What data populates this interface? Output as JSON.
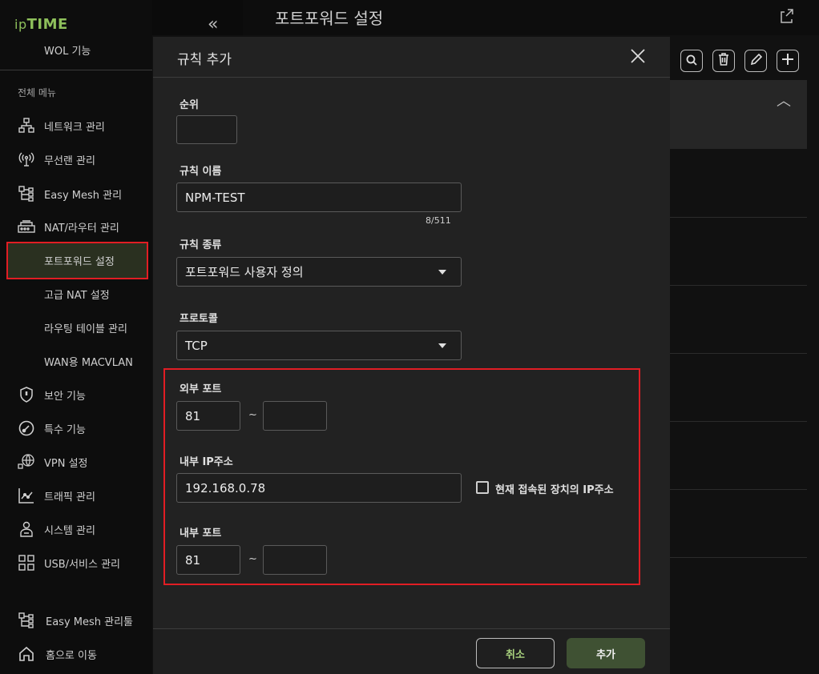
{
  "brand": {
    "logo_prefix": "ip",
    "logo_main": "TIME"
  },
  "sidebar": {
    "collapse_icon": "double-chevron-left-icon",
    "top_item": "WOL 기능",
    "section_label": "전체 메뉴",
    "items": [
      {
        "label": "네트워크 관리",
        "icon": "network-icon"
      },
      {
        "label": "무선랜 관리",
        "icon": "wireless-icon"
      },
      {
        "label": "Easy Mesh 관리",
        "icon": "mesh-icon"
      },
      {
        "label": "NAT/라우터 관리",
        "icon": "router-icon"
      },
      {
        "label": "포트포워드 설정",
        "icon": ""
      },
      {
        "label": "고급 NAT 설정",
        "icon": ""
      },
      {
        "label": "라우팅 테이블 관리",
        "icon": ""
      },
      {
        "label": "WAN용 MACVLAN",
        "icon": ""
      },
      {
        "label": "보안 기능",
        "icon": "shield-icon"
      },
      {
        "label": "특수 기능",
        "icon": "gauge-icon"
      },
      {
        "label": "VPN 설정",
        "icon": "globe-icon"
      },
      {
        "label": "트래픽 관리",
        "icon": "chart-icon"
      },
      {
        "label": "시스템 관리",
        "icon": "system-icon"
      },
      {
        "label": "USB/서비스 관리",
        "icon": "usb-icon"
      }
    ],
    "bottom_items": [
      {
        "label": "Easy Mesh 관리툴",
        "icon": "mesh-tool-icon"
      },
      {
        "label": "홈으로 이동",
        "icon": "home-icon"
      }
    ]
  },
  "page": {
    "title": "포트포워드 설정"
  },
  "modal": {
    "title": "규칙 추가",
    "fields": {
      "order_label": "순위",
      "order_value": "",
      "name_label": "규칙 이름",
      "name_value": "NPM-TEST",
      "name_counter": "8/511",
      "type_label": "규칙 종류",
      "type_value": "포트포워드 사용자 정의",
      "protocol_label": "프로토콜",
      "protocol_value": "TCP",
      "ext_port_label": "외부 포트",
      "ext_port_start": "81",
      "ext_port_end": "",
      "int_ip_label": "내부 IP주소",
      "int_ip_value": "192.168.0.78",
      "current_device_label": "현재 접속된 장치의 IP주소",
      "int_port_label": "내부 포트",
      "int_port_start": "81",
      "int_port_end": "",
      "range_sep": "~"
    },
    "buttons": {
      "cancel": "취소",
      "add": "추가"
    }
  }
}
